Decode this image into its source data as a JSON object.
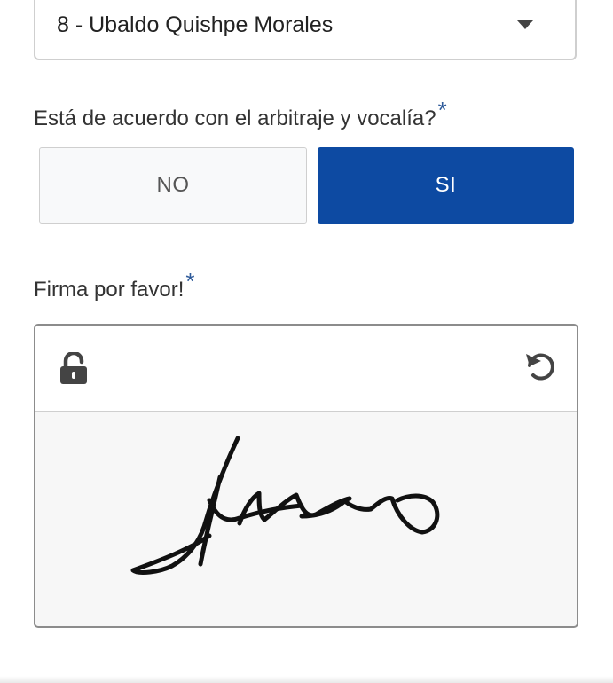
{
  "form": {
    "select": {
      "value": "8 - Ubaldo Quishpe Morales"
    },
    "question": {
      "label": "Está de acuerdo con el arbitraje y vocalía?",
      "required_mark": "*",
      "options": [
        {
          "label": "NO",
          "selected": false
        },
        {
          "label": "SI",
          "selected": true
        }
      ]
    },
    "signature": {
      "label": "Firma por favor!",
      "required_mark": "*",
      "lock_icon": "unlocked-padlock-icon",
      "reset_icon": "undo-icon"
    }
  },
  "colors": {
    "selected_button": "#0d4aa2",
    "unselected_button": "#f8f9fa",
    "required_mark": "#2f5b9a",
    "signature_background": "#f7f7f7"
  }
}
